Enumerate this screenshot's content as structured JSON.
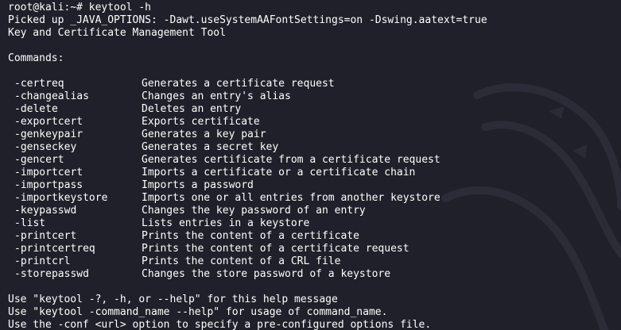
{
  "terminal": {
    "prompt": "root@kali:~# keytool -h",
    "java_options": "Picked up _JAVA_OPTIONS: -Dawt.useSystemAAFontSettings=on -Dswing.aatext=true",
    "tool_title": "Key and Certificate Management Tool",
    "commands_header": "Commands:",
    "commands": [
      {
        "name": "-certreq",
        "desc": "Generates a certificate request"
      },
      {
        "name": "-changealias",
        "desc": "Changes an entry's alias"
      },
      {
        "name": "-delete",
        "desc": "Deletes an entry"
      },
      {
        "name": "-exportcert",
        "desc": "Exports certificate"
      },
      {
        "name": "-genkeypair",
        "desc": "Generates a key pair"
      },
      {
        "name": "-genseckey",
        "desc": "Generates a secret key"
      },
      {
        "name": "-gencert",
        "desc": "Generates certificate from a certificate request"
      },
      {
        "name": "-importcert",
        "desc": "Imports a certificate or a certificate chain"
      },
      {
        "name": "-importpass",
        "desc": "Imports a password"
      },
      {
        "name": "-importkeystore",
        "desc": "Imports one or all entries from another keystore"
      },
      {
        "name": "-keypasswd",
        "desc": "Changes the key password of an entry"
      },
      {
        "name": "-list",
        "desc": "Lists entries in a keystore"
      },
      {
        "name": "-printcert",
        "desc": "Prints the content of a certificate"
      },
      {
        "name": "-printcertreq",
        "desc": "Prints the content of a certificate request"
      },
      {
        "name": "-printcrl",
        "desc": "Prints the content of a CRL file"
      },
      {
        "name": "-storepasswd",
        "desc": "Changes the store password of a keystore"
      }
    ],
    "footer": [
      "Use \"keytool -?, -h, or --help\" for this help message",
      "Use \"keytool -command_name --help\" for usage of command_name.",
      "Use the -conf <url> option to specify a pre-configured options file."
    ]
  },
  "colors": {
    "background": "#1f2029",
    "text": "#ffffff",
    "watermark": "#2a2b36"
  }
}
